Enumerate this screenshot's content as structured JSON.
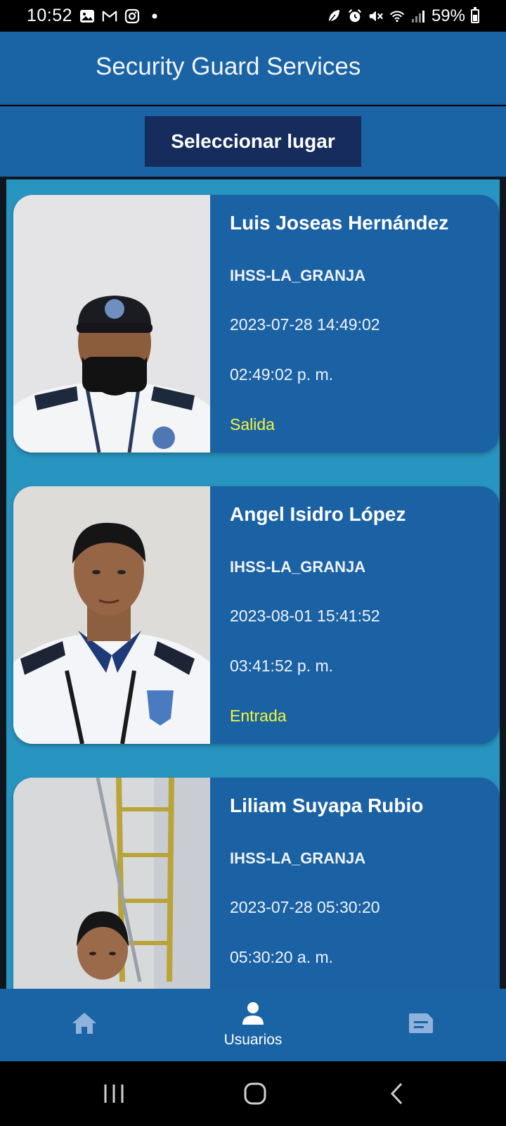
{
  "status_bar": {
    "time": "10:52",
    "notification_icons": [
      "image-icon",
      "gmail-icon",
      "instagram-icon",
      "dot-icon"
    ],
    "system_icons": [
      "leaf-icon",
      "alarm-icon",
      "mute-icon",
      "wifi-icon",
      "signal-icon"
    ],
    "battery": "59%"
  },
  "app_bar": {
    "title": "Security Guard Services"
  },
  "select_place": {
    "label": "Seleccionar lugar"
  },
  "records": [
    {
      "name": "Luis Joseas Hernández",
      "location": "IHSS-LA_GRANJA",
      "datetime": "2023-07-28 14:49:02",
      "time": "02:49:02 p. m.",
      "status": "Salida"
    },
    {
      "name": "Angel Isidro López",
      "location": "IHSS-LA_GRANJA",
      "datetime": "2023-08-01 15:41:52",
      "time": "03:41:52 p. m.",
      "status": "Entrada"
    },
    {
      "name": "Liliam Suyapa Rubio",
      "location": "IHSS-LA_GRANJA",
      "datetime": "2023-07-28 05:30:20",
      "time": "05:30:20 a. m.",
      "status": ""
    }
  ],
  "bottom_nav": {
    "items": [
      {
        "icon": "home-icon",
        "label": ""
      },
      {
        "icon": "person-icon",
        "label": "Usuarios"
      },
      {
        "icon": "document-icon",
        "label": ""
      }
    ]
  },
  "system_nav": [
    "recents-icon",
    "home-circle-icon",
    "back-icon"
  ],
  "colors": {
    "primary": "#1a63a5",
    "button_dark": "#152c5c",
    "list_bg": "#2894c0",
    "status_yellow": "#f5f53a"
  }
}
